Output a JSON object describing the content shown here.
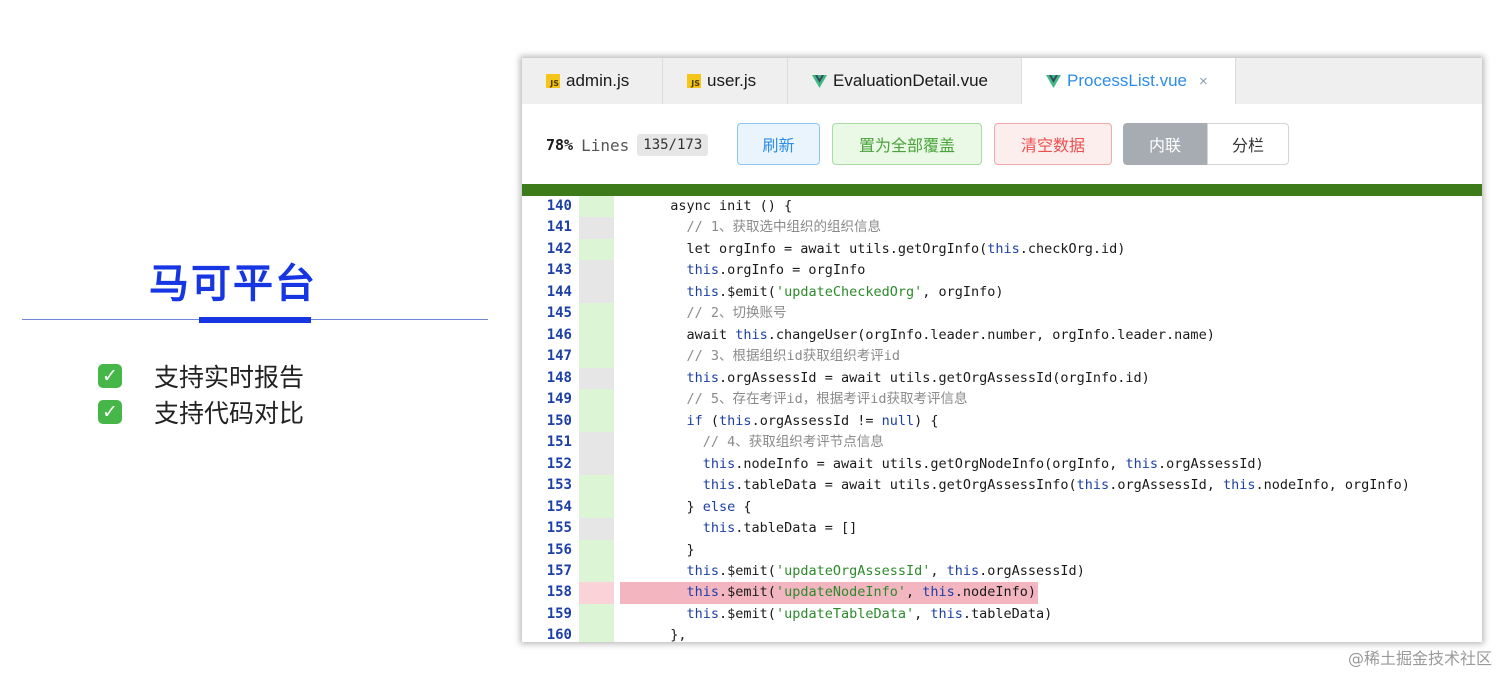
{
  "slide": {
    "title": "马可平台",
    "features": [
      {
        "check": "✓",
        "text": "支持实时报告"
      },
      {
        "check": "✓",
        "text": "支持代码对比"
      }
    ]
  },
  "tabs": [
    {
      "icon": "js-icon",
      "label": "admin.js"
    },
    {
      "icon": "js-icon",
      "label": "user.js"
    },
    {
      "icon": "vue-icon",
      "label": "EvaluationDetail.vue"
    },
    {
      "icon": "vue-icon",
      "label": "ProcessList.vue",
      "active": true,
      "close": "×"
    }
  ],
  "toolbar": {
    "coverage_pct": "78%",
    "lines_label": "Lines",
    "lines_count": "135/173",
    "refresh_label": "刷新",
    "cover_all_label": "置为全部覆盖",
    "clear_label": "清空数据",
    "inline_label": "内联",
    "split_label": "分栏"
  },
  "code": [
    {
      "n": "140",
      "cov": "g",
      "text": "  async init () {"
    },
    {
      "n": "141",
      "cov": "n",
      "text": "    // 1、获取选中组织的组织信息"
    },
    {
      "n": "142",
      "cov": "g",
      "text": "    let orgInfo = await utils.getOrgInfo(this.checkOrg.id)"
    },
    {
      "n": "143",
      "cov": "n",
      "text": "    this.orgInfo = orgInfo"
    },
    {
      "n": "144",
      "cov": "n",
      "text": "    this.$emit('updateCheckedOrg', orgInfo)"
    },
    {
      "n": "145",
      "cov": "g",
      "text": "    // 2、切换账号"
    },
    {
      "n": "146",
      "cov": "g",
      "text": "    await this.changeUser(orgInfo.leader.number, orgInfo.leader.name)"
    },
    {
      "n": "147",
      "cov": "g",
      "text": "    // 3、根据组织id获取组织考评id"
    },
    {
      "n": "148",
      "cov": "n",
      "text": "    this.orgAssessId = await utils.getOrgAssessId(orgInfo.id)"
    },
    {
      "n": "149",
      "cov": "g",
      "text": "    // 5、存在考评id，根据考评id获取考评信息"
    },
    {
      "n": "150",
      "cov": "g",
      "text": "    if (this.orgAssessId != null) {"
    },
    {
      "n": "151",
      "cov": "n",
      "text": "      // 4、获取组织考评节点信息"
    },
    {
      "n": "152",
      "cov": "n",
      "text": "      this.nodeInfo = await utils.getOrgNodeInfo(orgInfo, this.orgAssessId)"
    },
    {
      "n": "153",
      "cov": "g",
      "text": "      this.tableData = await utils.getOrgAssessInfo(this.orgAssessId, this.nodeInfo, orgInfo)"
    },
    {
      "n": "154",
      "cov": "g",
      "text": "    } else {"
    },
    {
      "n": "155",
      "cov": "n",
      "text": "      this.tableData = []"
    },
    {
      "n": "156",
      "cov": "g",
      "text": "    }"
    },
    {
      "n": "157",
      "cov": "g",
      "text": "    this.$emit('updateOrgAssessId', this.orgAssessId)"
    },
    {
      "n": "158",
      "cov": "r",
      "text": "    this.$emit('updateNodeInfo', this.nodeInfo)"
    },
    {
      "n": "159",
      "cov": "g",
      "text": "    this.$emit('updateTableData', this.tableData)"
    },
    {
      "n": "160",
      "cov": "g",
      "text": "  },"
    }
  ],
  "watermark": "@稀土掘金技术社区",
  "colors": {
    "brand": "#1736e3",
    "covered": "#dcf5d5",
    "neutral": "#e6e6e6",
    "uncovered": "#f3b6c1",
    "coverage_bar": "#3d7a1a"
  }
}
